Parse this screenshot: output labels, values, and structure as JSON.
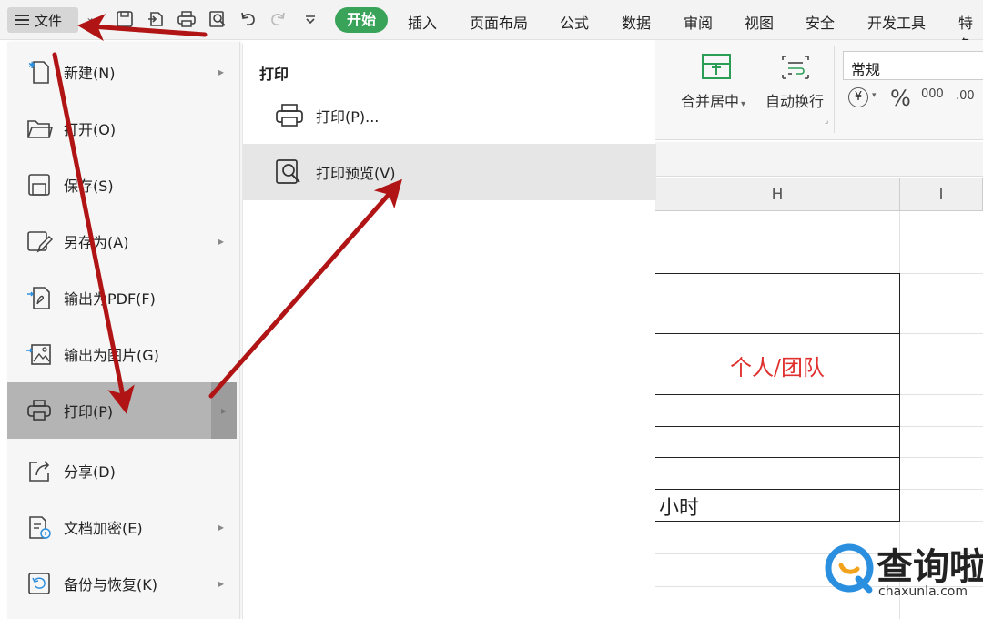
{
  "menubar": {
    "file_label": "文件",
    "tabs": [
      "开始",
      "插入",
      "页面布局",
      "公式",
      "数据",
      "审阅",
      "视图",
      "安全",
      "开发工具",
      "特色"
    ],
    "icons": [
      "save-icon",
      "export-icon",
      "print-icon",
      "print-preview-icon",
      "undo-icon",
      "redo-icon",
      "more-icon"
    ]
  },
  "ribbon": {
    "merge_label": "合并居中",
    "wrap_label": "自动换行",
    "format_value": "常规",
    "currency_symbol": "¥",
    "percent_symbol": "%",
    "thousands_symbol": "000",
    "decimal_symbol": ".00"
  },
  "sheet": {
    "col_h": "H",
    "col_i": "I",
    "red_cell": "个人/团队",
    "hours_cell": "小时"
  },
  "file_menu": {
    "items": [
      {
        "label": "新建(N)",
        "icon": "new-file-icon",
        "submenu": true
      },
      {
        "label": "打开(O)",
        "icon": "folder-icon",
        "submenu": false
      },
      {
        "label": "保存(S)",
        "icon": "save-icon",
        "submenu": false
      },
      {
        "label": "另存为(A)",
        "icon": "save-as-icon",
        "submenu": true
      },
      {
        "label": "输出为PDF(F)",
        "icon": "pdf-icon",
        "submenu": false
      },
      {
        "label": "输出为图片(G)",
        "icon": "image-icon",
        "submenu": false
      },
      {
        "label": "打印(P)",
        "icon": "print-icon",
        "submenu": true
      },
      {
        "label": "分享(D)",
        "icon": "share-icon",
        "submenu": false
      },
      {
        "label": "文档加密(E)",
        "icon": "encrypt-icon",
        "submenu": true
      },
      {
        "label": "备份与恢复(K)",
        "icon": "backup-icon",
        "submenu": true
      }
    ]
  },
  "print_submenu": {
    "title": "打印",
    "items": [
      {
        "label": "打印(P)...",
        "icon": "print-icon"
      },
      {
        "label": "打印预览(V)",
        "icon": "print-preview-icon"
      }
    ]
  },
  "watermark": {
    "main": "查询啦",
    "sub": "chaxunla.com"
  },
  "colors": {
    "accent_green": "#3aa35a",
    "annotation_red": "#b01414",
    "cell_red_text": "#e0312f",
    "watermark_blue": "#2b8fe0",
    "watermark_orange": "#f2a31b"
  }
}
